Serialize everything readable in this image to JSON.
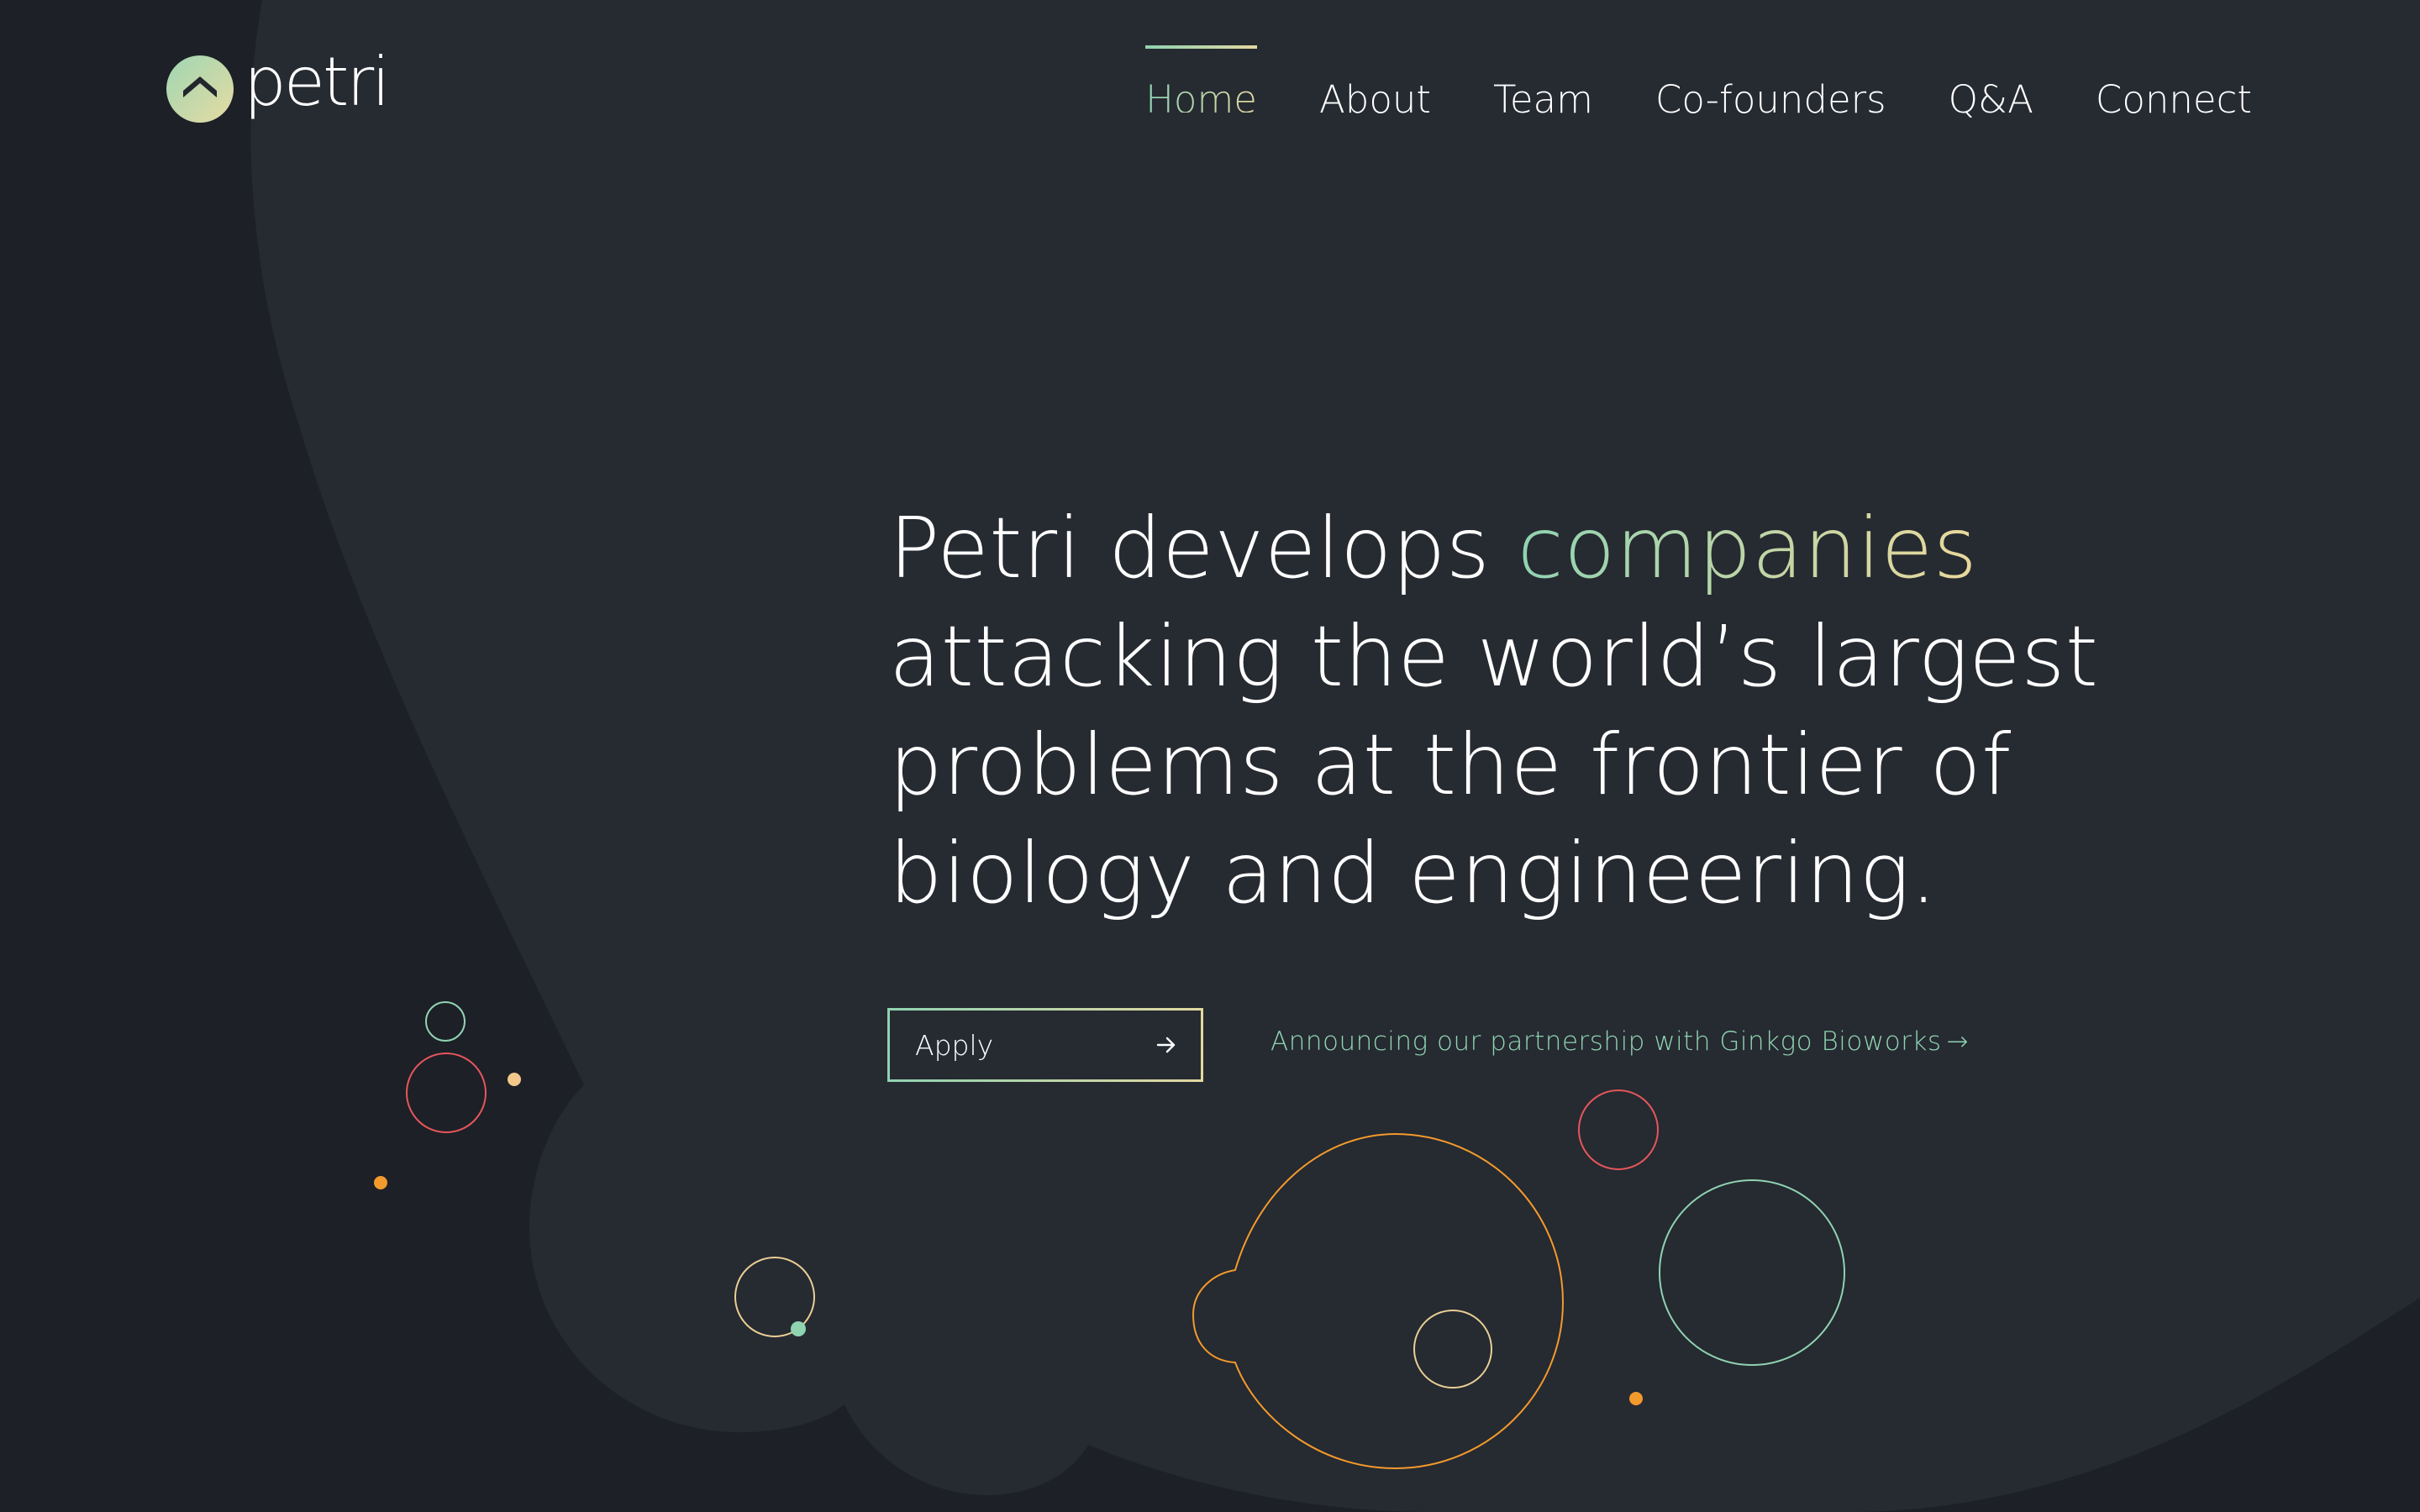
{
  "brand": {
    "name": "petri"
  },
  "nav": {
    "items": [
      {
        "label": "Home",
        "active": true
      },
      {
        "label": "About",
        "active": false
      },
      {
        "label": "Team",
        "active": false
      },
      {
        "label": "Co-founders",
        "active": false
      },
      {
        "label": "Q&A",
        "active": false
      },
      {
        "label": "Connect",
        "active": false
      }
    ]
  },
  "hero": {
    "headline_prefix": "Petri develops ",
    "headline_accent": "companies",
    "headline_suffix": " attacking the world’s largest problems at the frontier of biology and engineering."
  },
  "cta": {
    "apply_label": "Apply",
    "announcement": "Announcing our partnership with Ginkgo Bioworks",
    "announcement_arrow": "→"
  },
  "colors": {
    "background_outer": "#1d2027",
    "background_blob": "#262a31",
    "accent_green": "#8fd3b1",
    "accent_cream": "#e2d8a0",
    "accent_red": "#e5565b",
    "accent_orange": "#f39a2c",
    "text": "#ffffff"
  },
  "icons": {
    "logo": "petri-dish-chevron-icon",
    "apply": "arrow-right-icon"
  }
}
